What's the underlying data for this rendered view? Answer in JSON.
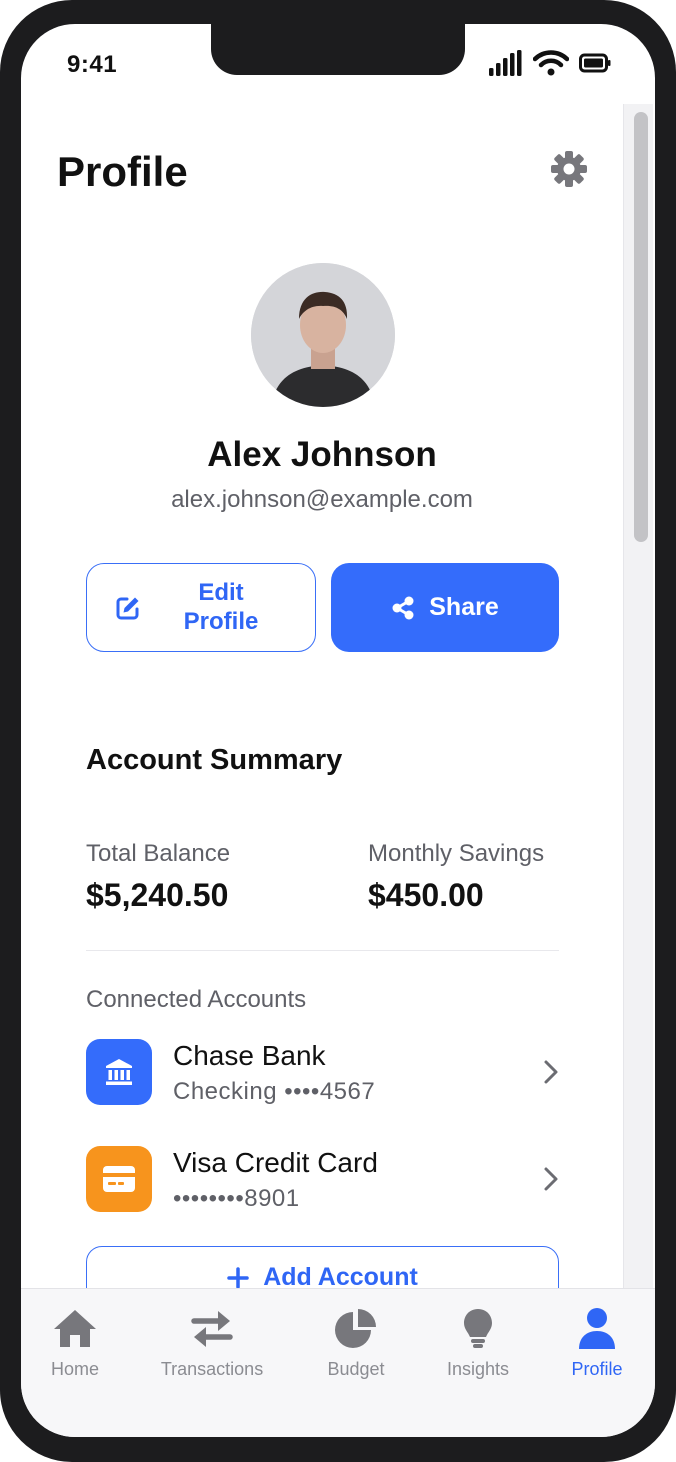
{
  "status_bar": {
    "time": "9:41"
  },
  "header": {
    "title": "Profile"
  },
  "user": {
    "name": "Alex Johnson",
    "email": "alex.johnson@example.com"
  },
  "actions": {
    "edit_label_line1": "Edit",
    "edit_label_line2": "Profile",
    "share_label": "Share"
  },
  "summary": {
    "title": "Account Summary",
    "total_balance_label": "Total Balance",
    "total_balance_value": "$5,240.50",
    "monthly_savings_label": "Monthly Savings",
    "monthly_savings_value": "$450.00"
  },
  "connected": {
    "title": "Connected Accounts",
    "accounts": [
      {
        "name": "Chase Bank",
        "detail": "Checking ••••4567",
        "icon": "bank-icon",
        "color": "#346cfb"
      },
      {
        "name": "Visa Credit Card",
        "detail": "••••••••8901",
        "icon": "credit-card-icon",
        "color": "#f7941d"
      }
    ],
    "add_label": "Add Account"
  },
  "tabs": [
    {
      "label": "Home",
      "icon": "home-icon"
    },
    {
      "label": "Transactions",
      "icon": "transfer-arrows-icon"
    },
    {
      "label": "Budget",
      "icon": "pie-chart-icon"
    },
    {
      "label": "Insights",
      "icon": "lightbulb-icon"
    },
    {
      "label": "Profile",
      "icon": "user-icon",
      "active": true
    }
  ],
  "colors": {
    "accent": "#346cfb",
    "text_secondary": "#5f6067",
    "tab_inactive": "#8b8c92"
  }
}
